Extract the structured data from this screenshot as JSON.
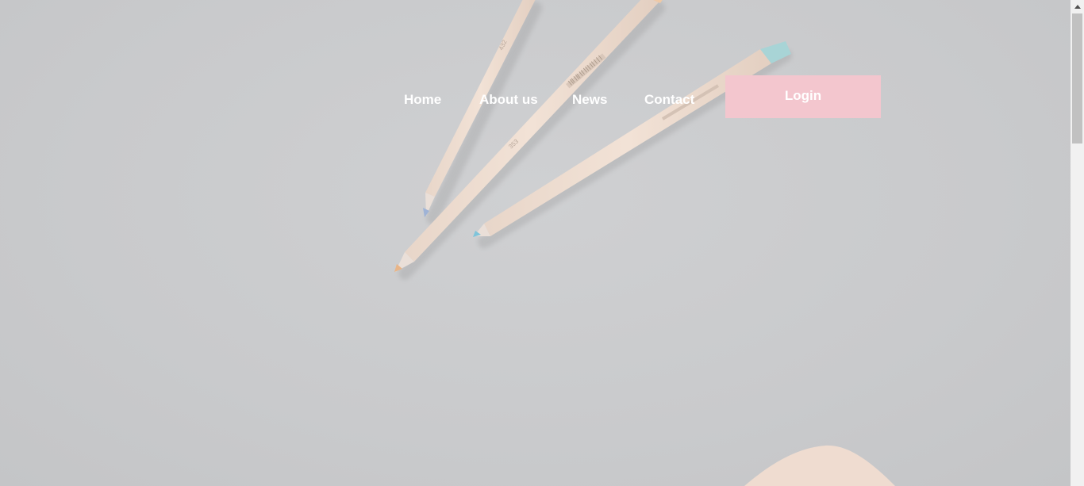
{
  "nav": {
    "items": [
      {
        "label": "Home"
      },
      {
        "label": "About us"
      },
      {
        "label": "News"
      },
      {
        "label": "Contact"
      }
    ],
    "login_label": "Login"
  },
  "colors": {
    "background": "#cbcccd",
    "login_button": "#f3c6ce",
    "nav_text": "#ffffff"
  },
  "hero": {
    "image": "pencils-on-gray-desk",
    "pencil_labels": [
      "432",
      "353"
    ]
  }
}
